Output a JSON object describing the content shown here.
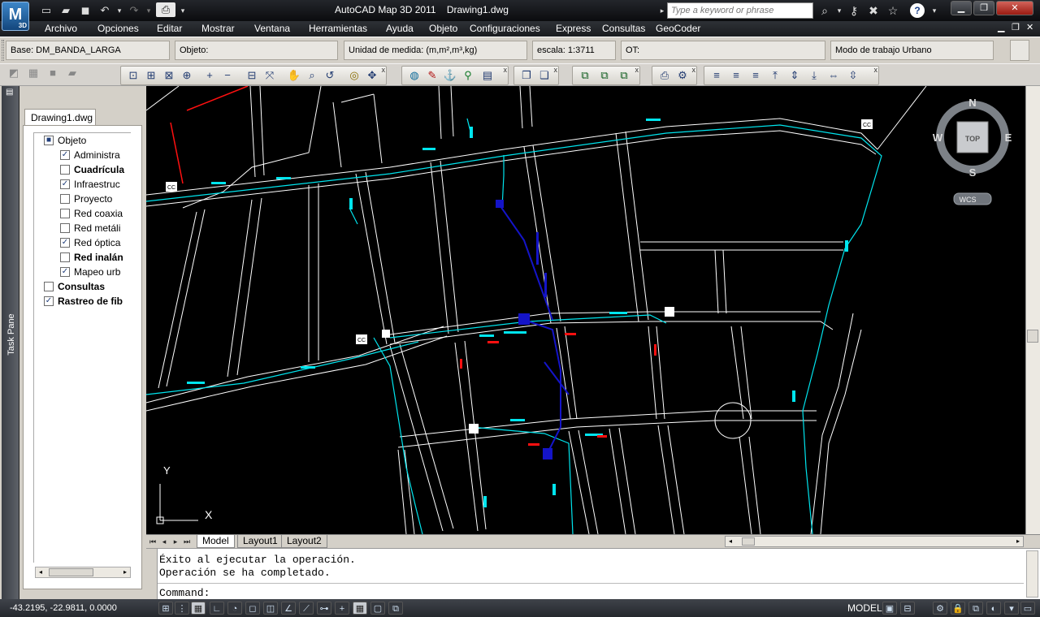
{
  "titlebar": {
    "title": "AutoCAD Map 3D 2011    Drawing1.dwg",
    "search_placeholder": "Type a keyword or phrase",
    "logo_text": "M",
    "logo_badge": "3D"
  },
  "menu": [
    {
      "label": "Archivo"
    },
    {
      "label": "Opciones"
    },
    {
      "label": "Editar"
    },
    {
      "label": "Mostrar"
    },
    {
      "label": "Ventana"
    },
    {
      "label": "Herramientas"
    },
    {
      "label": "Ayuda"
    },
    {
      "label": "Objeto"
    },
    {
      "label": "Configuraciones"
    },
    {
      "label": "Express"
    },
    {
      "label": "Consultas"
    },
    {
      "label": "GeoCoder"
    }
  ],
  "infobar": {
    "base": "Base: DM_BANDA_LARGA",
    "objeto": "Objeto:",
    "unidad": "Unidad de medida: (m,m²,m³,kg)",
    "escala": "escala: 1:3711",
    "ot": "OT:",
    "modo": "Modo de trabajo Urbano"
  },
  "taskpane": {
    "strip_label": "Task Pane",
    "tab_label": "Drawing1.dwg",
    "tree": [
      {
        "label": "Objeto",
        "checked": "■",
        "bold": false,
        "level": 0
      },
      {
        "label": "Administra",
        "checked": "✓",
        "bold": false,
        "level": 1
      },
      {
        "label": "Cuadrícula",
        "checked": "",
        "bold": true,
        "level": 1
      },
      {
        "label": "Infraestruc",
        "checked": "✓",
        "bold": false,
        "level": 1
      },
      {
        "label": "Proyecto",
        "checked": "",
        "bold": false,
        "level": 1
      },
      {
        "label": "Red coaxia",
        "checked": "",
        "bold": false,
        "level": 1
      },
      {
        "label": "Red metáli",
        "checked": "",
        "bold": false,
        "level": 1
      },
      {
        "label": "Red óptica",
        "checked": "✓",
        "bold": false,
        "level": 1
      },
      {
        "label": "Red inalán",
        "checked": "",
        "bold": true,
        "level": 1
      },
      {
        "label": "Mapeo urb",
        "checked": "✓",
        "bold": false,
        "level": 1
      },
      {
        "label": "Consultas",
        "checked": "",
        "bold": true,
        "level": 0
      },
      {
        "label": "Rastreo de fib",
        "checked": "✓",
        "bold": true,
        "level": 0
      }
    ]
  },
  "viewcube": {
    "north": "N",
    "south": "S",
    "east": "E",
    "west": "W",
    "top": "TOP",
    "wcs": "WCS"
  },
  "ucs": {
    "x": "X",
    "y": "Y"
  },
  "canvas_labels": [
    {
      "text": "CC"
    },
    {
      "text": "CC"
    },
    {
      "text": "CC"
    }
  ],
  "layout_tabs": [
    {
      "label": "Model"
    },
    {
      "label": "Layout1"
    },
    {
      "label": "Layout2"
    }
  ],
  "cmdline": {
    "line1": "Éxito al ejecutar la operación.",
    "line2": "Operación se ha completado.",
    "prompt": "Command:"
  },
  "statusbar": {
    "coords": "-43.2195, -22.9811, 0.0000",
    "model": "MODEL"
  },
  "colors": {
    "road": "#ffffff",
    "fiber": "#00e5ee",
    "red_net": "#ff1010",
    "blue_net": "#1414c8"
  }
}
